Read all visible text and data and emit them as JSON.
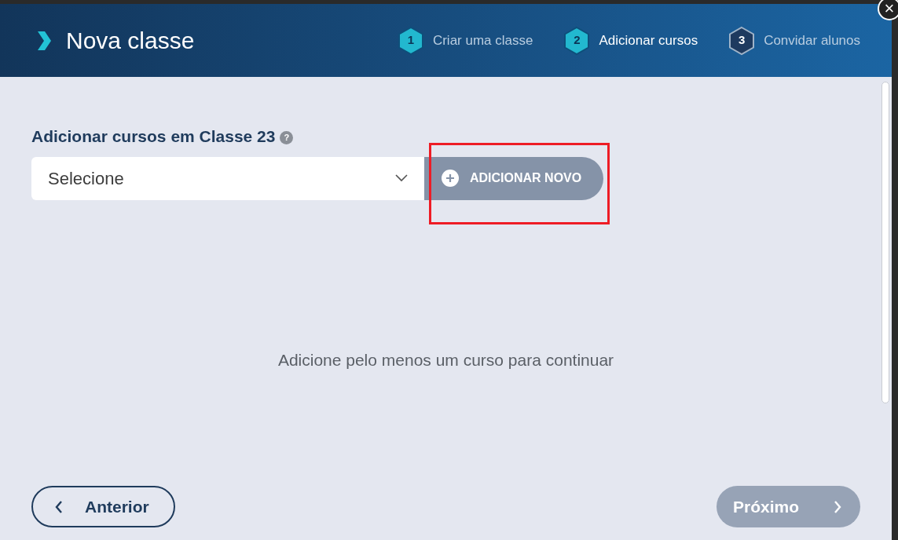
{
  "dialog": {
    "title": "Nova classe",
    "close_label": "×"
  },
  "steps": [
    {
      "number": "1",
      "label": "Criar uma classe",
      "kind": "done",
      "selected": false
    },
    {
      "number": "2",
      "label": "Adicionar cursos",
      "kind": "done",
      "selected": true
    },
    {
      "number": "3",
      "label": "Convidar alunos",
      "kind": "pending",
      "selected": false
    }
  ],
  "section": {
    "heading": "Adicionar cursos em Classe 23",
    "help_icon": "?"
  },
  "select": {
    "placeholder": "Selecione"
  },
  "add_button": {
    "label": "ADICIONAR NOVO",
    "highlighted": true
  },
  "empty_message": "Adicione pelo menos um curso para continuar",
  "footer": {
    "back": {
      "label": "Anterior",
      "disabled": false
    },
    "next": {
      "label": "Próximo",
      "disabled": true
    }
  }
}
